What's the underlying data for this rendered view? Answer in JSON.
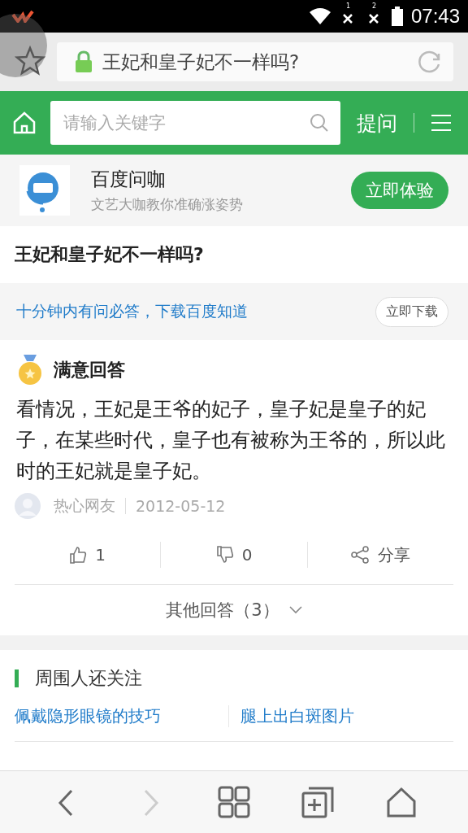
{
  "status_bar": {
    "sims": [
      "1",
      "2"
    ],
    "time": "07:43"
  },
  "address_bar": {
    "title": "王妃和皇子妃不一样吗?"
  },
  "header": {
    "search": {
      "placeholder": "请输入关键字"
    },
    "ask": "提问"
  },
  "promo": {
    "name": "百度问咖",
    "tagline": "文艺大咖教你准确涨姿势",
    "button": "立即体验"
  },
  "question": {
    "title": "王妃和皇子妃不一样吗?"
  },
  "download_banner": {
    "text": "十分钟内有问必答，下载百度知道",
    "button": "立即下载"
  },
  "answer": {
    "badge": "满意回答",
    "body": "看情况，王妃是王爷的妃子，皇子妃是皇子的妃子，在某些时代，皇子也有被称为王爷的，所以此时的王妃就是皇子妃。",
    "author": "热心网友",
    "date": "2012-05-12",
    "actions": [
      {
        "kind": "like",
        "label": "1"
      },
      {
        "kind": "dislike",
        "label": "0"
      },
      {
        "kind": "share",
        "label": "分享"
      }
    ],
    "more": "其他回答（3）"
  },
  "related": {
    "title": "周围人还关注",
    "links": [
      "佩戴隐形眼镜的技巧",
      "腿上出白斑图片"
    ]
  },
  "bottom_nav": [
    {
      "kind": "back",
      "disabled": false
    },
    {
      "kind": "forward",
      "disabled": true
    },
    {
      "kind": "apps",
      "disabled": false
    },
    {
      "kind": "tabs",
      "disabled": false
    },
    {
      "kind": "home",
      "disabled": false
    }
  ]
}
